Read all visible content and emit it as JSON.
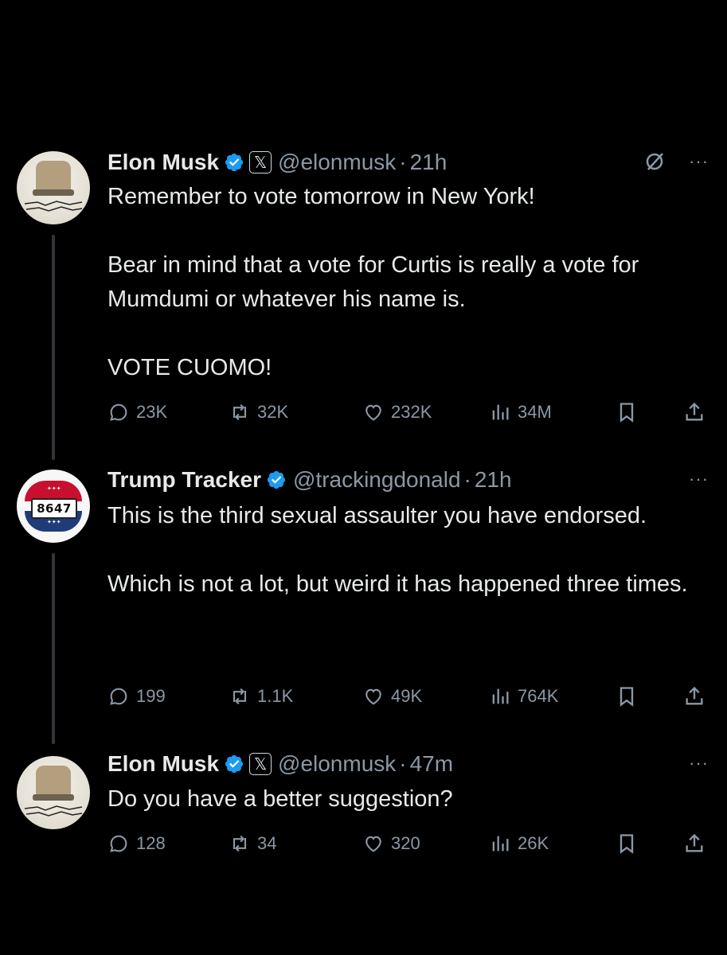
{
  "tweets": [
    {
      "name": "Elon Musk",
      "handle": "@elonmusk",
      "time": "21h",
      "affiliation": "𝕏",
      "paragraphs": [
        "Remember to vote tomorrow in New York!",
        "Bear in mind that a vote for Curtis is really a vote for Mumdumi or whatever his name is.",
        "VOTE CUOMO!"
      ],
      "stats": {
        "replies": "23K",
        "reposts": "32K",
        "likes": "232K",
        "views": "34M"
      }
    },
    {
      "name": "Trump Tracker",
      "handle": "@trackingdonald",
      "time": "21h",
      "avatar_text": "8647",
      "paragraphs": [
        "This is the third sexual assaulter you have endorsed.",
        "Which is not a lot, but weird it has happened three times."
      ],
      "stats": {
        "replies": "199",
        "reposts": "1.1K",
        "likes": "49K",
        "views": "764K"
      }
    },
    {
      "name": "Elon Musk",
      "handle": "@elonmusk",
      "time": "47m",
      "affiliation": "𝕏",
      "paragraphs": [
        "Do you have a better suggestion?"
      ],
      "stats": {
        "replies": "128",
        "reposts": "34",
        "likes": "320",
        "views": "26K"
      }
    }
  ],
  "separator": "·",
  "more_menu": "···",
  "icons": {
    "reply": "reply-icon",
    "repost": "repost-icon",
    "like": "heart-icon",
    "views": "views-icon",
    "bookmark": "bookmark-icon",
    "share": "share-icon",
    "grok": "grok-icon",
    "verified": "verified-badge-icon"
  },
  "colors": {
    "background": "#000000",
    "text": "#e7e9ea",
    "muted": "#8b98a5",
    "verified": "#1d9bf0"
  }
}
